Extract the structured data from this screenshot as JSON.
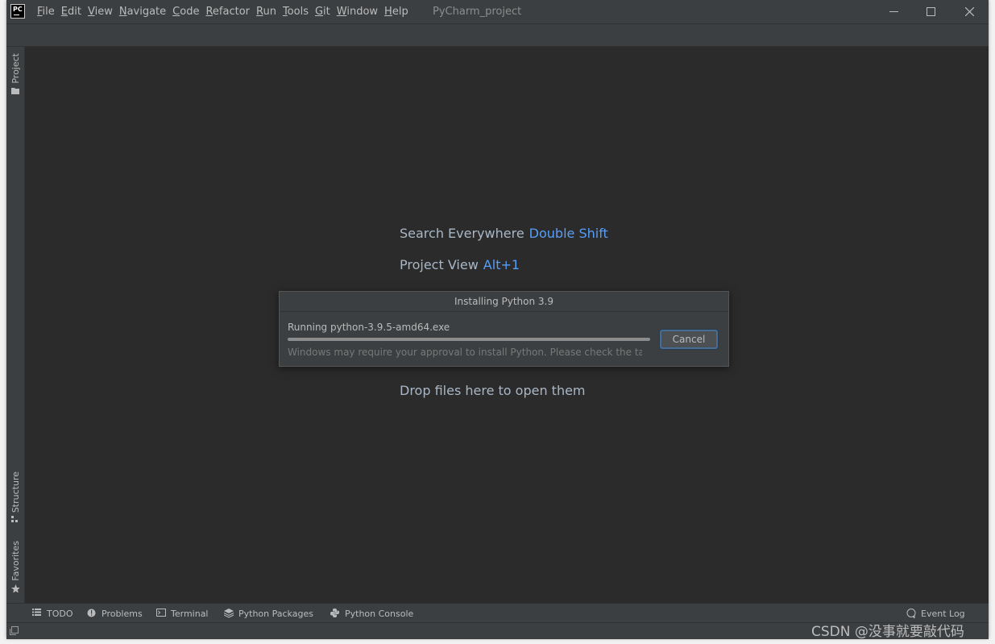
{
  "titlebar": {
    "menu": [
      "File",
      "Edit",
      "View",
      "Navigate",
      "Code",
      "Refactor",
      "Run",
      "Tools",
      "Git",
      "Window",
      "Help"
    ],
    "project_title": "PyCharm_project",
    "logo_text": "PC"
  },
  "left_strip": {
    "project_tab": "Project",
    "structure_tab": "Structure",
    "favorites_tab": "Favorites"
  },
  "editor": {
    "hint1_label": "Search Everywhere",
    "hint1_key": "Double Shift",
    "hint2_label": "Project View",
    "hint2_key": "Alt+1",
    "drop_text": "Drop files here to open them"
  },
  "dialog": {
    "title": "Installing Python 3.9",
    "running": "Running python-3.9.5-amd64.exe",
    "message": "Windows may require your approval to install Python. Please check the ta...",
    "cancel_label": "Cancel",
    "progress_fraction": 1.0
  },
  "bottom_bar": {
    "todo": "TODO",
    "problems": "Problems",
    "terminal": "Terminal",
    "python_packages": "Python Packages",
    "python_console": "Python Console",
    "event_log": "Event Log"
  },
  "watermark": "CSDN @没事就要敲代码",
  "colors": {
    "accent_key": "#589df6",
    "panel": "#3c3f41",
    "editor_bg": "#2b2b2b"
  }
}
